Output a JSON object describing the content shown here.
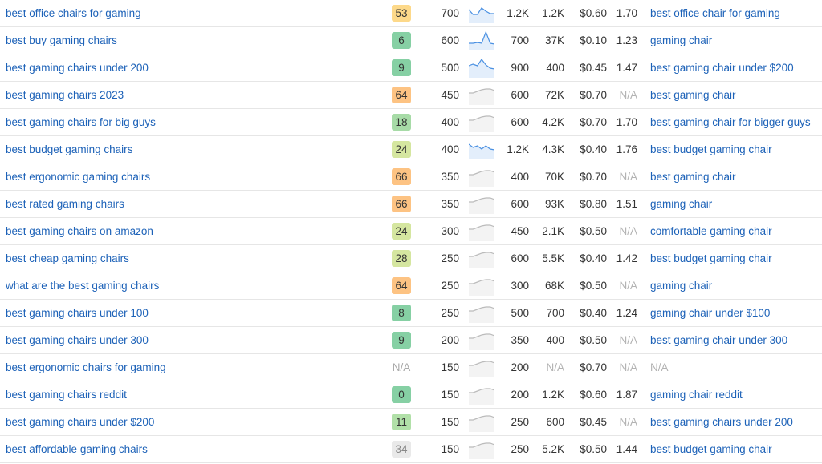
{
  "colors": {
    "link": "#1d62b8",
    "kd_orange": "#fdc383",
    "kd_yellow": "#fdd98a",
    "kd_green": "#86d0a4",
    "kd_lightgreen": "#b1e0a8",
    "kd_yellowgreen": "#d5e6a0",
    "kd_grey": "#e9e9e9",
    "spark_blue": "#4a90e2",
    "spark_grey": "#bbbbbb"
  },
  "rows": [
    {
      "keyword": "best office chairs for gaming",
      "kd": "53",
      "kd_color": "#fdd98a",
      "volume": "700",
      "trend": "blue",
      "trend_points": [
        8,
        14,
        14,
        6,
        10,
        13,
        13
      ],
      "traffic_potential": "1.2K",
      "traffic": "1.2K",
      "cpc": "$0.60",
      "cps": "1.70",
      "parent_topic": "best office chair for gaming"
    },
    {
      "keyword": "best buy gaming chairs",
      "kd": "6",
      "kd_color": "#86d0a4",
      "volume": "600",
      "trend": "blue",
      "trend_points": [
        16,
        16,
        15,
        16,
        2,
        16,
        17
      ],
      "traffic_potential": "700",
      "traffic": "37K",
      "cpc": "$0.10",
      "cps": "1.23",
      "parent_topic": "gaming chair"
    },
    {
      "keyword": "best gaming chairs under 200",
      "kd": "9",
      "kd_color": "#86d0a4",
      "volume": "500",
      "trend": "blue",
      "trend_points": [
        10,
        8,
        10,
        2,
        9,
        13,
        14
      ],
      "traffic_potential": "900",
      "traffic": "400",
      "cpc": "$0.45",
      "cps": "1.47",
      "parent_topic": "best gaming chair under $200"
    },
    {
      "keyword": "best gaming chairs 2023",
      "kd": "64",
      "kd_color": "#fdc383",
      "volume": "450",
      "trend": "grey",
      "trend_points": [
        10,
        10,
        8,
        6,
        5,
        5,
        7
      ],
      "traffic_potential": "600",
      "traffic": "72K",
      "cpc": "$0.70",
      "cps": "N/A",
      "parent_topic": "best gaming chair"
    },
    {
      "keyword": "best gaming chairs for big guys",
      "kd": "18",
      "kd_color": "#a7dba7",
      "volume": "400",
      "trend": "grey",
      "trend_points": [
        10,
        10,
        8,
        6,
        5,
        5,
        7
      ],
      "traffic_potential": "600",
      "traffic": "4.2K",
      "cpc": "$0.70",
      "cps": "1.70",
      "parent_topic": "best gaming chair for bigger guys"
    },
    {
      "keyword": "best budget gaming chairs",
      "kd": "24",
      "kd_color": "#d5e6a0",
      "volume": "400",
      "trend": "blue",
      "trend_points": [
        6,
        10,
        8,
        12,
        8,
        12,
        13
      ],
      "traffic_potential": "1.2K",
      "traffic": "4.3K",
      "cpc": "$0.40",
      "cps": "1.76",
      "parent_topic": "best budget gaming chair"
    },
    {
      "keyword": "best ergonomic gaming chairs",
      "kd": "66",
      "kd_color": "#fdc383",
      "volume": "350",
      "trend": "grey",
      "trend_points": [
        10,
        10,
        8,
        6,
        5,
        5,
        7
      ],
      "traffic_potential": "400",
      "traffic": "70K",
      "cpc": "$0.70",
      "cps": "N/A",
      "parent_topic": "best gaming chair"
    },
    {
      "keyword": "best rated gaming chairs",
      "kd": "66",
      "kd_color": "#fdc383",
      "volume": "350",
      "trend": "grey",
      "trend_points": [
        10,
        10,
        8,
        6,
        5,
        5,
        7
      ],
      "traffic_potential": "600",
      "traffic": "93K",
      "cpc": "$0.80",
      "cps": "1.51",
      "parent_topic": "gaming chair"
    },
    {
      "keyword": "best gaming chairs on amazon",
      "kd": "24",
      "kd_color": "#d5e6a0",
      "volume": "300",
      "trend": "grey",
      "trend_points": [
        10,
        10,
        8,
        6,
        5,
        5,
        7
      ],
      "traffic_potential": "450",
      "traffic": "2.1K",
      "cpc": "$0.50",
      "cps": "N/A",
      "parent_topic": "comfortable gaming chair"
    },
    {
      "keyword": "best cheap gaming chairs",
      "kd": "28",
      "kd_color": "#d5e6a0",
      "volume": "250",
      "trend": "grey",
      "trend_points": [
        10,
        10,
        8,
        6,
        5,
        5,
        7
      ],
      "traffic_potential": "600",
      "traffic": "5.5K",
      "cpc": "$0.40",
      "cps": "1.42",
      "parent_topic": "best budget gaming chair"
    },
    {
      "keyword": "what are the best gaming chairs",
      "kd": "64",
      "kd_color": "#fdc383",
      "volume": "250",
      "trend": "grey",
      "trend_points": [
        10,
        10,
        8,
        6,
        5,
        5,
        7
      ],
      "traffic_potential": "300",
      "traffic": "68K",
      "cpc": "$0.50",
      "cps": "N/A",
      "parent_topic": "gaming chair"
    },
    {
      "keyword": "best gaming chairs under 100",
      "kd": "8",
      "kd_color": "#86d0a4",
      "volume": "250",
      "trend": "grey",
      "trend_points": [
        10,
        10,
        8,
        6,
        5,
        5,
        7
      ],
      "traffic_potential": "500",
      "traffic": "700",
      "cpc": "$0.40",
      "cps": "1.24",
      "parent_topic": "gaming chair under $100"
    },
    {
      "keyword": "best gaming chairs under 300",
      "kd": "9",
      "kd_color": "#86d0a4",
      "volume": "200",
      "trend": "grey",
      "trend_points": [
        10,
        10,
        8,
        6,
        5,
        5,
        7
      ],
      "traffic_potential": "350",
      "traffic": "400",
      "cpc": "$0.50",
      "cps": "N/A",
      "parent_topic": "best gaming chair under 300"
    },
    {
      "keyword": "best ergonomic chairs for gaming",
      "kd": "N/A",
      "kd_color": "",
      "volume": "150",
      "trend": "grey",
      "trend_points": [
        10,
        10,
        8,
        6,
        5,
        5,
        7
      ],
      "traffic_potential": "200",
      "traffic": "N/A",
      "cpc": "$0.70",
      "cps": "N/A",
      "parent_topic": "N/A"
    },
    {
      "keyword": "best gaming chairs reddit",
      "kd": "0",
      "kd_color": "#86d0a4",
      "volume": "150",
      "trend": "grey",
      "trend_points": [
        10,
        10,
        8,
        6,
        5,
        5,
        7
      ],
      "traffic_potential": "200",
      "traffic": "1.2K",
      "cpc": "$0.60",
      "cps": "1.87",
      "parent_topic": "gaming chair reddit"
    },
    {
      "keyword": "best gaming chairs under $200",
      "kd": "11",
      "kd_color": "#b1e0a8",
      "volume": "150",
      "trend": "grey",
      "trend_points": [
        10,
        10,
        8,
        6,
        5,
        5,
        7
      ],
      "traffic_potential": "250",
      "traffic": "600",
      "cpc": "$0.45",
      "cps": "N/A",
      "parent_topic": "best gaming chairs under 200"
    },
    {
      "keyword": "best affordable gaming chairs",
      "kd": "34",
      "kd_color": "#e9e9e9",
      "volume": "150",
      "trend": "grey",
      "trend_points": [
        10,
        10,
        8,
        6,
        5,
        5,
        7
      ],
      "traffic_potential": "250",
      "traffic": "5.2K",
      "cpc": "$0.50",
      "cps": "1.44",
      "parent_topic": "best budget gaming chair"
    }
  ]
}
